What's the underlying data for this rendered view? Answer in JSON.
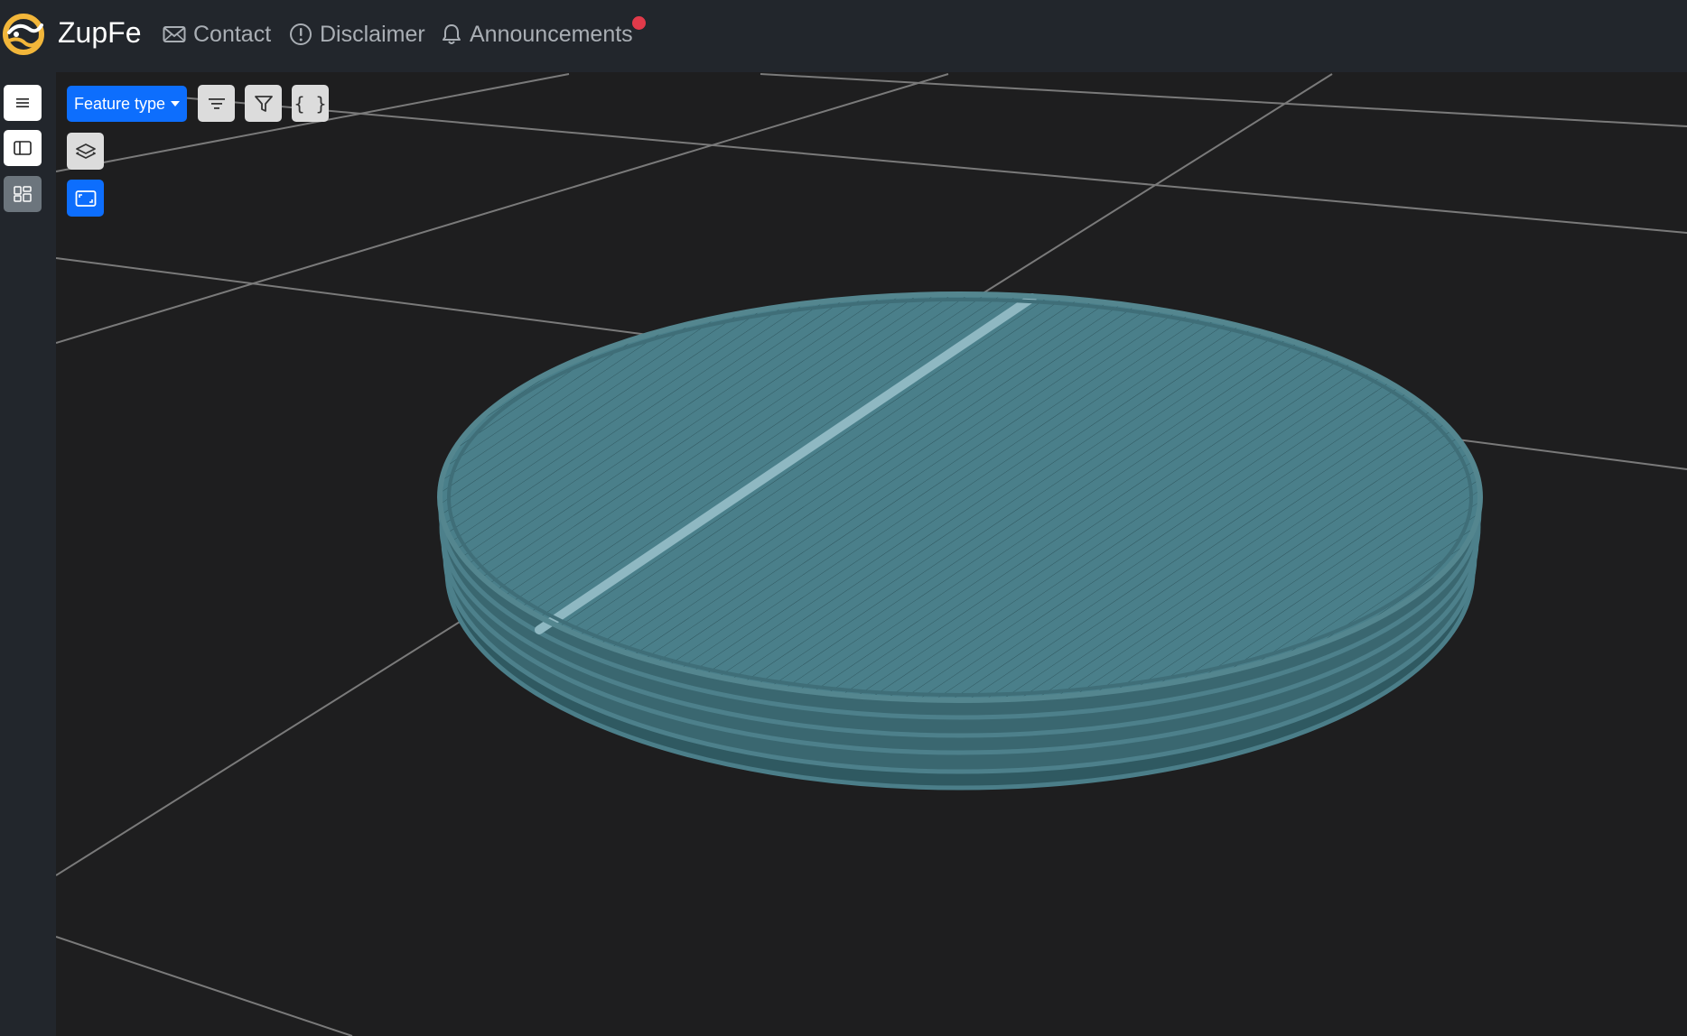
{
  "app": {
    "brand": "ZupFe",
    "accent_color": "#0d6efd",
    "notification_color": "#e13a4a"
  },
  "nav": {
    "items": [
      {
        "label": "Contact",
        "icon": "envelope-icon"
      },
      {
        "label": "Disclaimer",
        "icon": "exclamation-circle-icon"
      },
      {
        "label": "Announcements",
        "icon": "bell-icon",
        "has_notification": true
      }
    ]
  },
  "sidebar": {
    "items": [
      {
        "icon": "menu-icon",
        "state": "default"
      },
      {
        "icon": "panel-icon",
        "state": "default"
      },
      {
        "icon": "dashboard-icon",
        "state": "active"
      }
    ]
  },
  "toolbar": {
    "feature_type_label": "Feature type",
    "json_label": "{ }",
    "icons": [
      "sort-icon",
      "filter-icon",
      "json-braces-icon",
      "layers-icon",
      "frame-icon"
    ]
  },
  "viewport": {
    "background_color": "#1e1e1f",
    "grid_color": "#7a7a7a",
    "model_color": "#3f6e78",
    "highlight_color": "#8fb8c2"
  }
}
